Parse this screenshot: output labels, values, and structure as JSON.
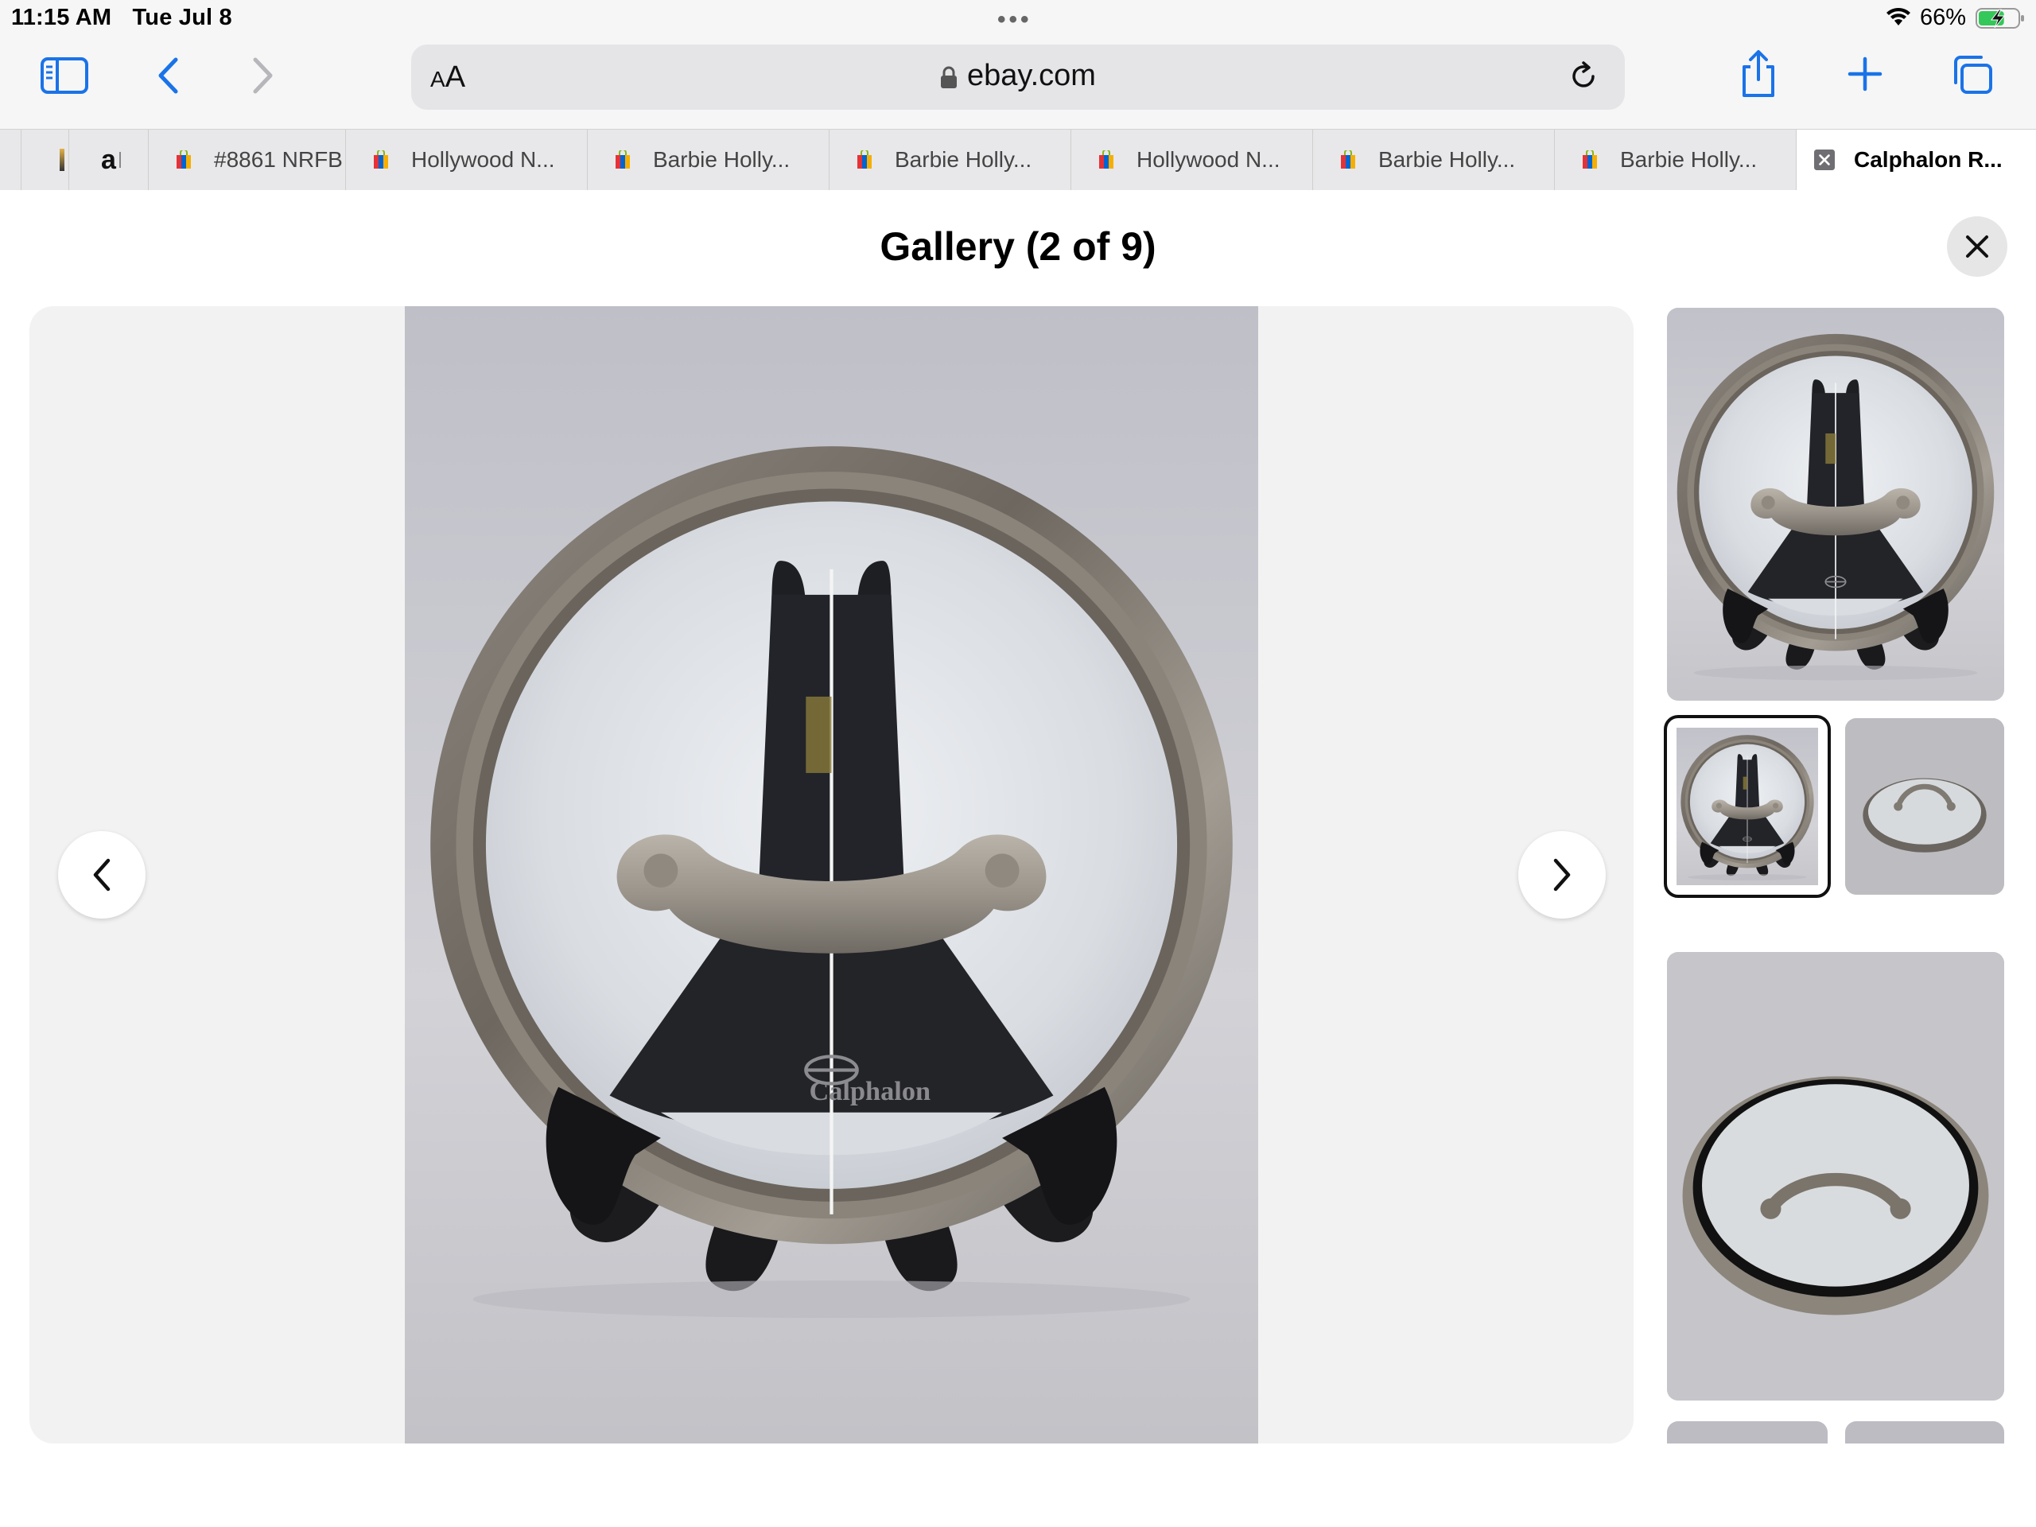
{
  "status": {
    "time": "11:15 AM",
    "date": "Tue Jul 8",
    "battery_percent": "66%",
    "battery_level": 0.66,
    "charging": true
  },
  "browser": {
    "aa_label_small": "A",
    "aa_label_large": "A",
    "url": "ebay.com",
    "icons": [
      "sidebar-icon",
      "back-icon",
      "forward-icon",
      "lock-icon",
      "reload-icon",
      "share-icon",
      "new-tab-icon",
      "tabs-overview-icon"
    ]
  },
  "tabs": [
    {
      "label": "",
      "favicon": "unknown"
    },
    {
      "label": "a",
      "favicon": "amazon"
    },
    {
      "label": "#8861 NRFB",
      "favicon": "ebay-bag"
    },
    {
      "label": "Hollywood N...",
      "favicon": "ebay-bag"
    },
    {
      "label": "Barbie Holly...",
      "favicon": "ebay-bag"
    },
    {
      "label": "Barbie Holly...",
      "favicon": "ebay-bag"
    },
    {
      "label": "Hollywood N...",
      "favicon": "ebay-bag"
    },
    {
      "label": "Barbie Holly...",
      "favicon": "ebay-bag"
    },
    {
      "label": "Barbie Holly...",
      "favicon": "ebay-bag"
    },
    {
      "label": "Calphalon R...",
      "favicon": "close-tab",
      "active": true
    }
  ],
  "gallery": {
    "title": "Gallery (2 of 9)",
    "current_index": 2,
    "total": 9,
    "photo_logo_text": "Calphalon",
    "thumbnails": [
      {
        "index": 1,
        "selected": false
      },
      {
        "index": 2,
        "selected": true
      },
      {
        "index": 3,
        "selected": false
      },
      {
        "index": 4,
        "selected": false
      }
    ]
  },
  "colors": {
    "accent_blue": "#1a73e8",
    "chrome_bg": "#f6f6f6",
    "tab_bar": "#e8e8ea",
    "viewer_bg": "#f2f2f2",
    "battery_green": "#34c759"
  }
}
